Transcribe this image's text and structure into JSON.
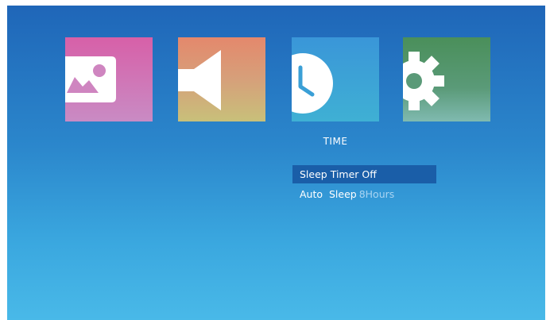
{
  "menu": {
    "tiles": [
      {
        "icon": "picture-icon",
        "color": "#d760a8"
      },
      {
        "icon": "speaker-icon",
        "color": "#e4886c"
      },
      {
        "icon": "clock-icon",
        "color": "#3a96d8"
      },
      {
        "icon": "gear-icon",
        "color": "#4a8f5a"
      }
    ],
    "selected_section": "TIME",
    "items": [
      {
        "label": "Sleep Timer Off",
        "value": ""
      },
      {
        "label": "Auto  Sleep",
        "value": "8Hours"
      }
    ],
    "highlight_color": "#1a5ea8"
  }
}
